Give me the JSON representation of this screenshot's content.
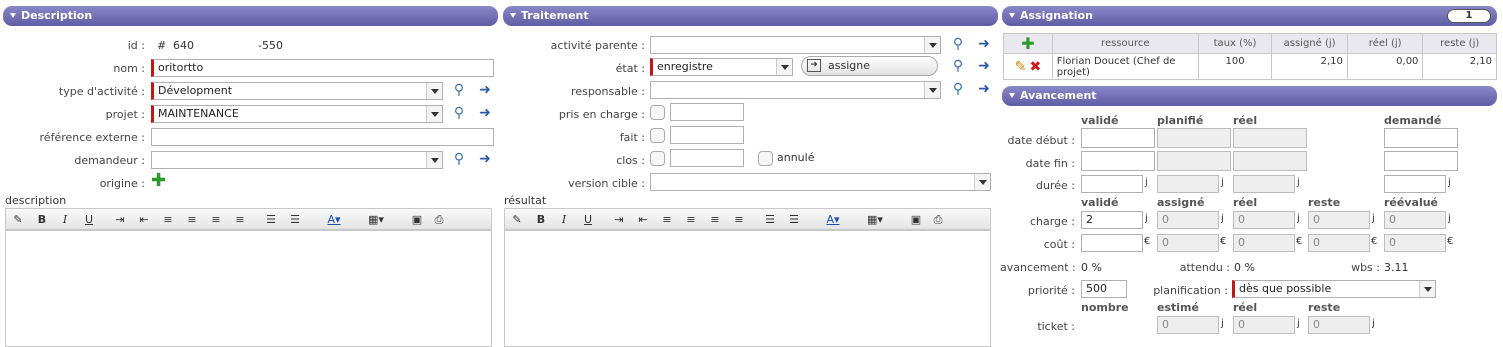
{
  "description": {
    "header": "Description",
    "id_label": "id :",
    "id_hash": "#",
    "id_value": "640",
    "id_ref": "-550",
    "name_label": "nom :",
    "name_value": "oritortto",
    "type_label": "type d'activité :",
    "type_value": "Dévelopment",
    "project_label": "projet :",
    "project_value": "MAINTENANCE",
    "extref_label": "référence externe :",
    "extref_value": "",
    "requester_label": "demandeur :",
    "requester_value": "",
    "origin_label": "origine :",
    "desc_label": "description"
  },
  "treatment": {
    "header": "Traitement",
    "parent_label": "activité parente :",
    "parent_value": "",
    "state_label": "état :",
    "state_value": "enregistre",
    "assign_button": "assigne",
    "resp_label": "responsable :",
    "resp_value": "",
    "taken_label": "pris en charge :",
    "done_label": "fait :",
    "closed_label": "clos :",
    "cancelled_label": "annulé",
    "target_label": "version cible :",
    "target_value": "",
    "result_label": "résultat"
  },
  "assignment": {
    "header": "Assignation",
    "count": "1",
    "columns": [
      "ressource",
      "taux (%)",
      "assigné (j)",
      "réel (j)",
      "reste (j)"
    ],
    "rows": [
      {
        "resource": "Florian Doucet (Chef de projet)",
        "rate": "100",
        "assigned": "2,10",
        "real": "0,00",
        "left": "2,10"
      }
    ]
  },
  "progress": {
    "header": "Avancement",
    "col_validated": "validé",
    "col_planned": "planifié",
    "col_real": "réel",
    "col_requested": "demandé",
    "start_label": "date début :",
    "end_label": "date fin :",
    "duration_label": "durée :",
    "unit_day": "j",
    "unit_eur": "€",
    "c2_validated": "validé",
    "c2_assigned": "assigné",
    "c2_real": "réel",
    "c2_left": "reste",
    "c2_reeval": "réévalué",
    "work_label": "charge :",
    "work_validated": "2",
    "work_assigned": "0",
    "work_real": "0",
    "work_left": "0",
    "work_reeval": "0",
    "cost_label": "coût :",
    "cost_validated": "",
    "cost_assigned": "0",
    "cost_real": "0",
    "cost_left": "0",
    "cost_reeval": "0",
    "progress_label": "avancement :",
    "progress_value": "0 %",
    "expected_label": "attendu :",
    "expected_value": "0 %",
    "wbs_label": "wbs :",
    "wbs_value": "3.11",
    "priority_label": "priorité :",
    "priority_value": "500",
    "planning_label": "planification :",
    "planning_value": "dès que possible",
    "c3_number": "nombre",
    "c3_estimated": "estimé",
    "c3_real": "réel",
    "c3_left": "reste",
    "ticket_label": "ticket :",
    "ticket_estimated": "0",
    "ticket_real": "0",
    "ticket_left": "0"
  },
  "editor_toolbar": [
    "eraser-icon",
    "bold-icon",
    "italic-icon",
    "underline-icon",
    "indent-icon",
    "outdent-icon",
    "align-left-icon",
    "align-center-icon",
    "align-right-icon",
    "justify-icon",
    "ordered-list-icon",
    "unordered-list-icon",
    "text-color-icon",
    "highlight-icon",
    "fullscreen-icon",
    "print-icon"
  ],
  "colors": {
    "header": "#6f6cb3",
    "required": "#c01818",
    "add": "#2e9a2e"
  }
}
